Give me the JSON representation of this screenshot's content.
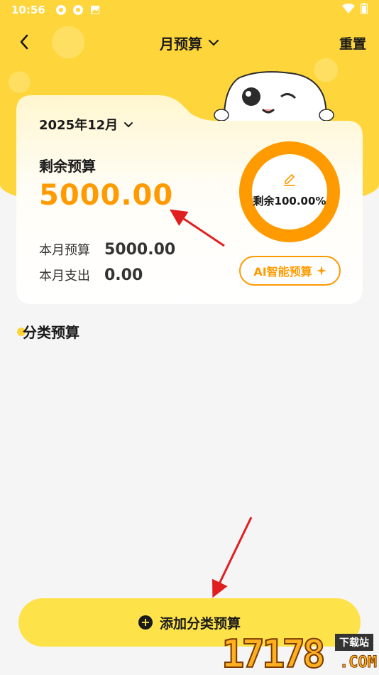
{
  "status_bar": {
    "time": "10:56"
  },
  "nav": {
    "title": "月预算",
    "reset_label": "重置"
  },
  "card": {
    "date": "2025年12月",
    "remain_label": "剩余预算",
    "remain_amount": "5000.00",
    "budget_label": "本月预算",
    "budget_value": "5000.00",
    "spend_label": "本月支出",
    "spend_value": "0.00",
    "ring_text": "剩余100.00%",
    "ring_fraction": 1.0,
    "ai_button": "AI智能预算"
  },
  "section": {
    "title": "分类预算"
  },
  "add_button": {
    "label": "添加分类预算"
  },
  "watermark": {
    "text": "17178",
    "tag": "下载站",
    "suffix": ".COM"
  },
  "colors": {
    "accent": "#ff9a00",
    "yellow": "#fed53a",
    "button": "#fde24a",
    "arrow": "#e02020"
  }
}
